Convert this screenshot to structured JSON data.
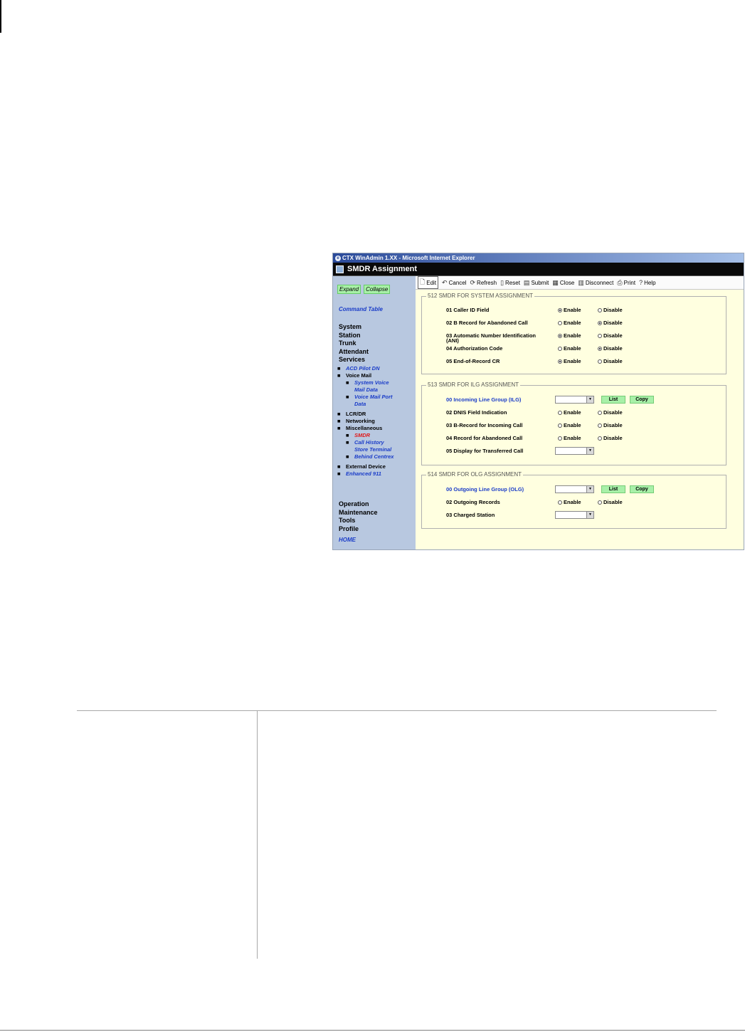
{
  "window": {
    "ie_title": "CTX WinAdmin 1.XX - Microsoft Internet Explorer",
    "app_title": "SMDR Assignment"
  },
  "toolbar": {
    "buttons": [
      "Edit",
      "Cancel",
      "Refresh",
      "Reset",
      "Submit",
      "Close",
      "Disconnect",
      "Print",
      "Help"
    ]
  },
  "sidebar": {
    "expand": "Expand",
    "collapse": "Collapse",
    "command_table": "Command Table",
    "main_items": [
      "System",
      "Station",
      "Trunk",
      "Attendant",
      "Services"
    ],
    "services_items": {
      "acd_pilot": "ACD Pilot DN",
      "voice_mail": "Voice Mail",
      "system_voice_mail_data_1": "System Voice",
      "system_voice_mail_data_2": "Mail Data",
      "voice_mail_port_data_1": "Voice Mail Port",
      "voice_mail_port_data_2": "Data",
      "lcr_dr": "LCR/DR",
      "networking": "Networking",
      "miscellaneous": "Miscellaneous",
      "smdr": "SMDR",
      "call_history_1": "Call History",
      "store_terminal": "Store Terminal",
      "behind_centrex": "Behind Centrex",
      "external_device": "External Device",
      "enhanced_911": "Enhanced 911"
    },
    "lower_items": [
      "Operation",
      "Maintenance",
      "Tools",
      "Profile"
    ],
    "home": "HOME"
  },
  "sections": {
    "system": {
      "title": "512 SMDR FOR SYSTEM ASSIGNMENT",
      "rows": [
        {
          "label": "01 Caller ID Field",
          "enable": "Enable",
          "disable": "Disable"
        },
        {
          "label": "02 B Record for Abandoned Call",
          "enable": "Enable",
          "disable": "Disable"
        },
        {
          "label": "03 Automatic Number Identification",
          "label2": "(ANI)",
          "enable": "Enable",
          "disable": "Disable"
        },
        {
          "label": "04 Authorization Code",
          "enable": "Enable",
          "disable": "Disable"
        },
        {
          "label": "05 End-of-Record CR",
          "enable": "Enable",
          "disable": "Disable"
        }
      ],
      "selected": [
        "enable",
        "disable",
        "enable",
        "disable",
        "enable"
      ]
    },
    "ilg": {
      "title": "513 SMDR FOR ILG ASSIGNMENT",
      "row_00": "00 Incoming Line Group (ILG)",
      "list": "List",
      "copy": "Copy",
      "rows": [
        {
          "label": "02 DNIS Field Indication",
          "enable": "Enable",
          "disable": "Disable"
        },
        {
          "label": "03 B-Record for Incoming Call",
          "enable": "Enable",
          "disable": "Disable"
        },
        {
          "label": "04 Record for Abandoned Call",
          "enable": "Enable",
          "disable": "Disable"
        }
      ],
      "row_05": "05 Display for Transferred Call"
    },
    "olg": {
      "title": "514 SMDR FOR OLG ASSIGNMENT",
      "row_00": "00 Outgoing Line Group (OLG)",
      "list": "List",
      "copy": "Copy",
      "row_02": "02 Outgoing Records",
      "enable": "Enable",
      "disable": "Disable",
      "row_03": "03 Charged Station"
    }
  }
}
